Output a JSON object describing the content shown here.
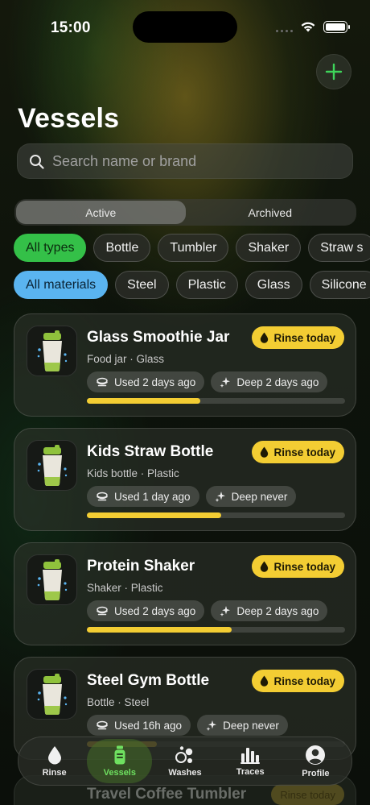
{
  "status_bar": {
    "time": "15:00"
  },
  "header": {
    "title": "Vessels",
    "add_icon": "plus-icon"
  },
  "search": {
    "placeholder": "Search name or brand",
    "value": ""
  },
  "segments": [
    {
      "label": "Active",
      "active": true
    },
    {
      "label": "Archived",
      "active": false
    }
  ],
  "type_filters": [
    "All types",
    "Bottle",
    "Tumbler",
    "Shaker",
    "Straw s"
  ],
  "material_filters": [
    "All materials",
    "Steel",
    "Plastic",
    "Glass",
    "Silicone"
  ],
  "vessels": [
    {
      "name": "Glass Smoothie Jar",
      "subtitle": "Food jar · Glass",
      "badge": "Rinse today",
      "used": "Used 2 days ago",
      "deep": "Deep 2 days ago",
      "progress": 0.44
    },
    {
      "name": "Kids Straw Bottle",
      "subtitle": "Kids bottle · Plastic",
      "badge": "Rinse today",
      "used": "Used 1 day ago",
      "deep": "Deep never",
      "progress": 0.52
    },
    {
      "name": "Protein Shaker",
      "subtitle": "Shaker · Plastic",
      "badge": "Rinse today",
      "used": "Used 2 days ago",
      "deep": "Deep 2 days ago",
      "progress": 0.56
    },
    {
      "name": "Steel Gym Bottle",
      "subtitle": "Bottle · Steel",
      "badge": "Rinse today",
      "used": "Used 16h ago",
      "deep": "Deep never",
      "progress": 0.27
    }
  ],
  "peek_vessel": {
    "name": "Travel Coffee Tumbler",
    "badge": "Rinse today"
  },
  "tabs": [
    {
      "label": "Rinse",
      "icon": "drop-icon",
      "active": false
    },
    {
      "label": "Vessels",
      "icon": "bottle-icon",
      "active": true
    },
    {
      "label": "Washes",
      "icon": "bubbles-icon",
      "active": false
    },
    {
      "label": "Traces",
      "icon": "bar-chart-icon",
      "active": false
    },
    {
      "label": "Profile",
      "icon": "person-icon",
      "active": false
    }
  ],
  "colors": {
    "accent_green": "#34c048",
    "accent_blue": "#5ab4f0",
    "badge_yellow": "#f3cd33"
  }
}
